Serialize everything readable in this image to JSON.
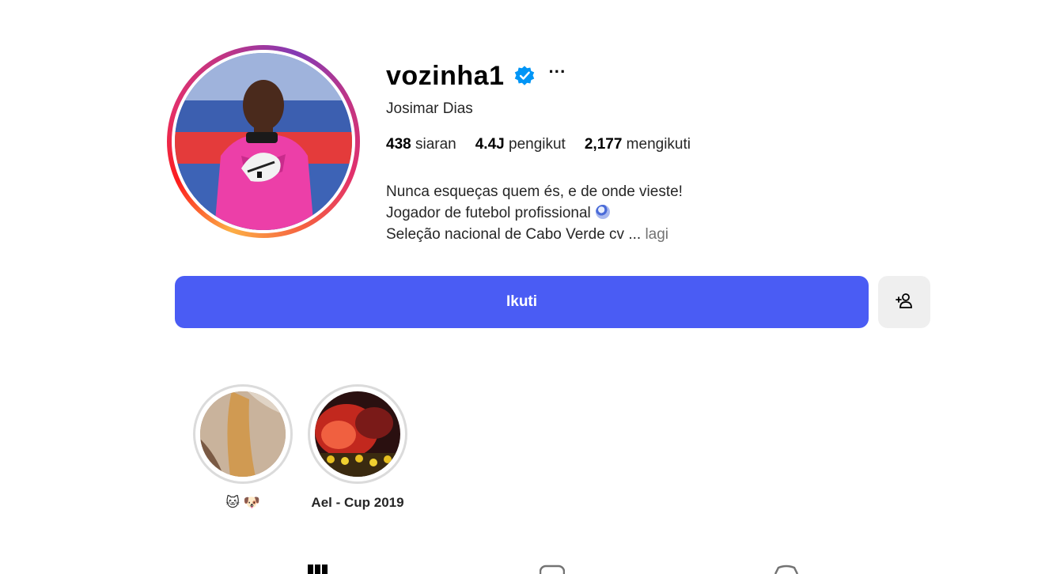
{
  "profile": {
    "username": "vozinha1",
    "full_name": "Josimar Dias",
    "verified_icon": "verified-badge-icon",
    "more_label": "···"
  },
  "stats": {
    "posts_count": "438",
    "posts_label": "siaran",
    "followers_count": "4.4J",
    "followers_label": "pengikut",
    "following_count": "2,177",
    "following_label": "mengikuti"
  },
  "bio": {
    "line1": "Nunca esqueças quem és, e de onde vieste!",
    "line2": "Jogador de futebol profissional",
    "line3": "Seleção nacional de Cabo Verde cv ...",
    "more_link": "lagi"
  },
  "actions": {
    "follow_label": "Ikuti",
    "suggest_icon": "person-add-icon"
  },
  "highlights": [
    {
      "label": "🐱 🐶"
    },
    {
      "label": "Ael - Cup 2019"
    }
  ],
  "tabs": [
    "grid-icon",
    "reels-icon",
    "tagged-icon"
  ],
  "colors": {
    "follow_button": "#4a5cf4",
    "verified_badge": "#0095f6",
    "secondary_button": "#efefef"
  }
}
